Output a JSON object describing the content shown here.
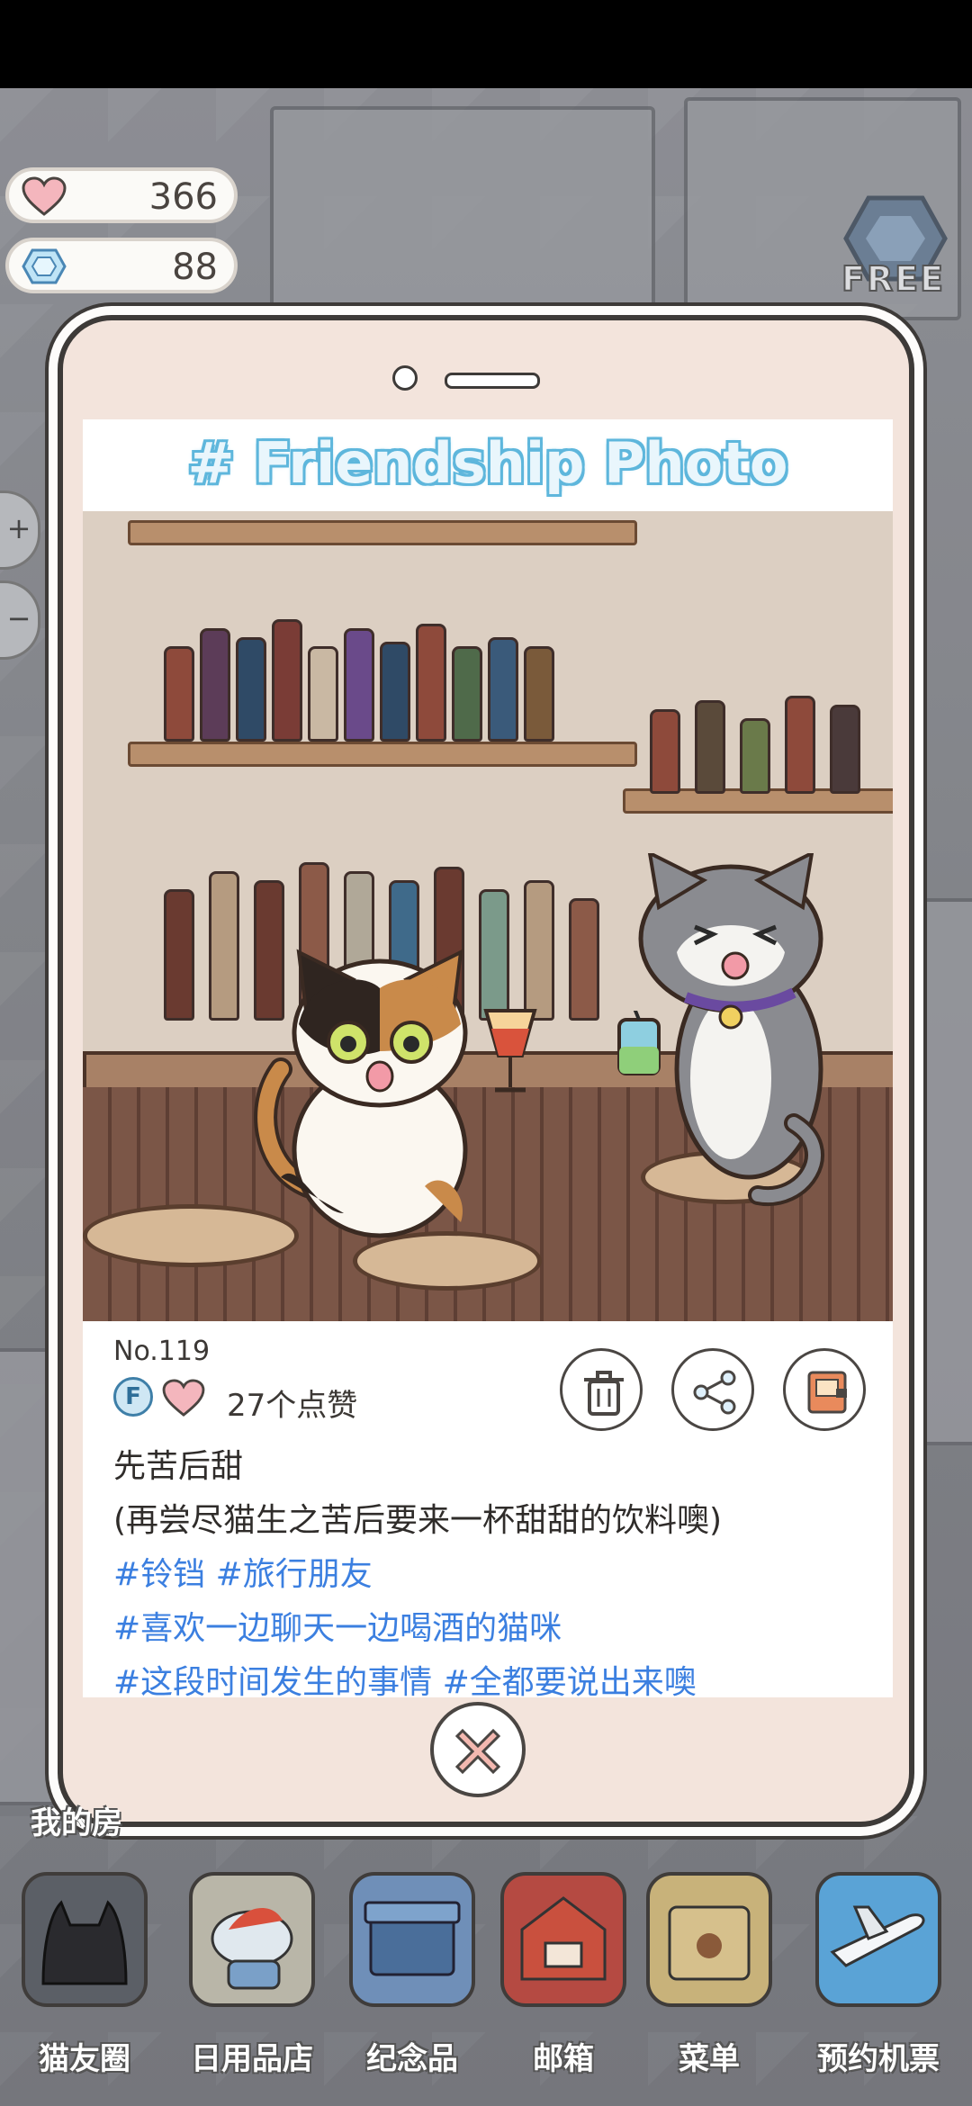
{
  "hud": {
    "hearts": "366",
    "gems": "88",
    "free_label": "FREE"
  },
  "side_controls": [
    "+",
    "−"
  ],
  "card": {
    "title": "# Friendship Photo",
    "number": "No.119",
    "friend_badge": "F",
    "likes": "27个点赞",
    "caption_line1": "先苦后甜",
    "caption_line2": "(再尝尽猫生之苦后要来一杯甜甜的饮料噢)",
    "tags_line1": "#铃铛 #旅行朋友",
    "tags_line2": "#喜欢一边聊天一边喝酒的猫咪",
    "tags_line3": "#这段时间发生的事情 #全都要说出来噢"
  },
  "my_room_label": "我的房",
  "nav": [
    {
      "label": "猫友圈",
      "icon": "cat-circle-icon",
      "color": "#5b5f66"
    },
    {
      "label": "日用品店",
      "icon": "shop-icon",
      "color": "#b9b6a8"
    },
    {
      "label": "纪念品",
      "icon": "souvenir-box-icon",
      "color": "#6f8fb8"
    },
    {
      "label": "邮箱",
      "icon": "mailbox-icon",
      "color": "#b54a42"
    },
    {
      "label": "菜单",
      "icon": "menu-folder-icon",
      "color": "#c8b27a"
    },
    {
      "label": "预约机票",
      "icon": "airplane-icon",
      "color": "#5aa3d6"
    }
  ]
}
